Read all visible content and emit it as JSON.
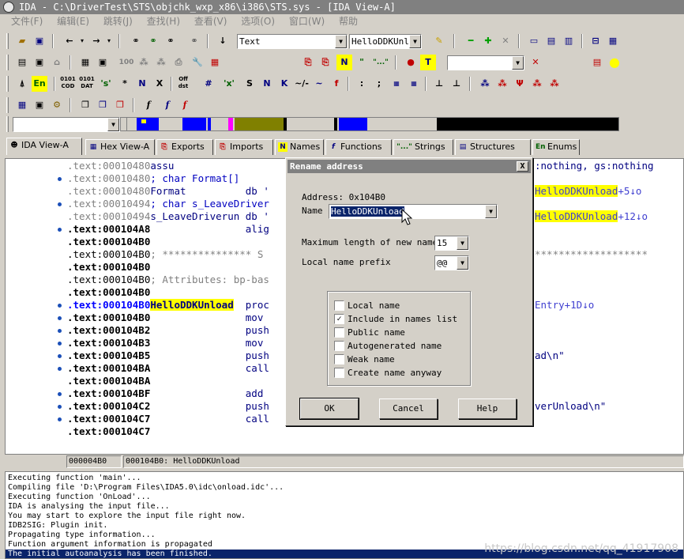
{
  "window": {
    "title": "IDA - C:\\DriverTest\\STS\\objchk_wxp_x86\\i386\\STS.sys - [IDA View-A]"
  },
  "menu": [
    "文件(F)",
    "编辑(E)",
    "跳转(J)",
    "查找(H)",
    "查看(V)",
    "选项(O)",
    "窗口(W)",
    "帮助"
  ],
  "toolbar": {
    "segment_combo": "Text",
    "name_combo": "HelloDDKUnlo",
    "icons_row3": [
      "0101 COD",
      "0101 DAT",
      "'s'",
      "*",
      "N",
      "X",
      "Off dst",
      "#",
      "'x'",
      "S",
      "N",
      "K",
      "~/-",
      "~",
      "f",
      ":",
      ";"
    ]
  },
  "tabs": [
    {
      "label": "IDA View-A",
      "icon": "ida-icon"
    },
    {
      "label": "Hex View-A",
      "icon": "hex-icon"
    },
    {
      "label": "Exports",
      "icon": "exports-icon"
    },
    {
      "label": "Imports",
      "icon": "imports-icon"
    },
    {
      "label": "Names",
      "icon": "names-icon"
    },
    {
      "label": "Functions",
      "icon": "functions-icon"
    },
    {
      "label": "Strings",
      "icon": "strings-icon"
    },
    {
      "label": "Structures",
      "icon": "structures-icon"
    },
    {
      "label": "Enums",
      "icon": "enums-icon"
    }
  ],
  "code_lines": [
    {
      "addr": ".text:00010480",
      "rest": "assu",
      "tail": ":nothing, gs:nothing",
      "tail_hl": "",
      "tail_suffix": ""
    },
    {
      "addr": ".text:00010480",
      "rest": "; char Format[]",
      "tail": "",
      "tail_hl": "",
      "tail_suffix": ""
    },
    {
      "addr": ".text:00010480",
      "rest": "Format          db '",
      "tail": "",
      "tail_hl": "HelloDDKUnload",
      "tail_suffix": "+5↓o"
    },
    {
      "addr": ".text:00010494",
      "rest": "; char s_LeaveDriver",
      "tail": "",
      "tail_hl": "",
      "tail_suffix": ""
    },
    {
      "addr": ".text:00010494",
      "rest": "s_LeaveDriverun db '",
      "tail": "",
      "tail_hl": "HelloDDKUnload",
      "tail_suffix": "+12↓o"
    },
    {
      "addr": ".text:000104A8",
      "rest": "                alig",
      "tail": "",
      "tail_hl": "",
      "tail_suffix": ""
    },
    {
      "addr": ".text:000104B0",
      "rest": "",
      "tail": "",
      "tail_hl": "",
      "tail_suffix": ""
    },
    {
      "addr": ".text:000104B0",
      "rest": "; *************** S",
      "tail": "*******************",
      "tail_hl": "",
      "tail_suffix": ""
    },
    {
      "addr": ".text:000104B0",
      "rest": "",
      "tail": "",
      "tail_hl": "",
      "tail_suffix": ""
    },
    {
      "addr": ".text:000104B0",
      "rest": "; Attributes: bp-bas",
      "tail": "",
      "tail_hl": "",
      "tail_suffix": ""
    },
    {
      "addr": ".text:000104B0",
      "rest": "",
      "tail": "",
      "tail_hl": "",
      "tail_suffix": ""
    },
    {
      "addr": ".text:000104B0",
      "rest": "HelloDDKUnload  proc",
      "tail": "Entry+1D↓o",
      "tail_hl": "",
      "tail_suffix": ""
    },
    {
      "addr": ".text:000104B0",
      "rest": "                mov",
      "tail": "",
      "tail_hl": "",
      "tail_suffix": ""
    },
    {
      "addr": ".text:000104B2",
      "rest": "                push",
      "tail": "",
      "tail_hl": "",
      "tail_suffix": ""
    },
    {
      "addr": ".text:000104B3",
      "rest": "                mov",
      "tail": "",
      "tail_hl": "",
      "tail_suffix": ""
    },
    {
      "addr": ".text:000104B5",
      "rest": "                push",
      "tail": "ad\\n\"",
      "tail_hl": "",
      "tail_suffix": ""
    },
    {
      "addr": ".text:000104BA",
      "rest": "                call",
      "tail": "",
      "tail_hl": "",
      "tail_suffix": ""
    },
    {
      "addr": ".text:000104BA",
      "rest": "",
      "tail": "",
      "tail_hl": "",
      "tail_suffix": ""
    },
    {
      "addr": ".text:000104BF",
      "rest": "                add",
      "tail": "",
      "tail_hl": "",
      "tail_suffix": ""
    },
    {
      "addr": ".text:000104C2",
      "rest": "                push",
      "tail": "verUnload\\n\"",
      "tail_hl": "",
      "tail_suffix": ""
    },
    {
      "addr": ".text:000104C7",
      "rest": "                call",
      "tail": "",
      "tail_hl": "",
      "tail_suffix": ""
    },
    {
      "addr": ".text:000104C7",
      "rest": "",
      "tail": "",
      "tail_hl": "",
      "tail_suffix": ""
    }
  ],
  "status": {
    "offset": "000004B0",
    "location": "000104B0: HelloDDKUnload"
  },
  "output_lines": [
    "Executing function 'main'...",
    "Compiling file 'D:\\Program Files\\IDA5.0\\idc\\onload.idc'...",
    "Executing function 'OnLoad'...",
    "IDA is analysing the input file...",
    "You may start to explore the input file right now.",
    "IDB2SIG: Plugin init.",
    "Propagating type information...",
    "Function argument information is propagated",
    "The initial autoanalysis has been finished."
  ],
  "watermark": "https://blog.csdn.net/qq_41917908",
  "dialog": {
    "title": "Rename address",
    "close": "X",
    "address_label": "Address: 0x104B0",
    "name_label": "Name",
    "name_value": "HelloDDKUnload",
    "max_len_label": "Maximum length of new names",
    "max_len_value": "15",
    "prefix_label": "Local name prefix",
    "prefix_value": "@@",
    "checks": [
      {
        "label": "Local name",
        "checked": false
      },
      {
        "label": "Include in names list",
        "checked": true
      },
      {
        "label": "Public name",
        "checked": false
      },
      {
        "label": "Autogenerated name",
        "checked": false
      },
      {
        "label": "Weak name",
        "checked": false
      },
      {
        "label": "Create name anyway",
        "checked": false
      }
    ],
    "ok": "OK",
    "cancel": "Cancel",
    "help": "Help"
  },
  "colors": {
    "highlight": "#ffff00",
    "code_blue": "#000080",
    "bullet": "#1b4fb8",
    "xref": "#3a3ad0",
    "comment": "#808080"
  }
}
